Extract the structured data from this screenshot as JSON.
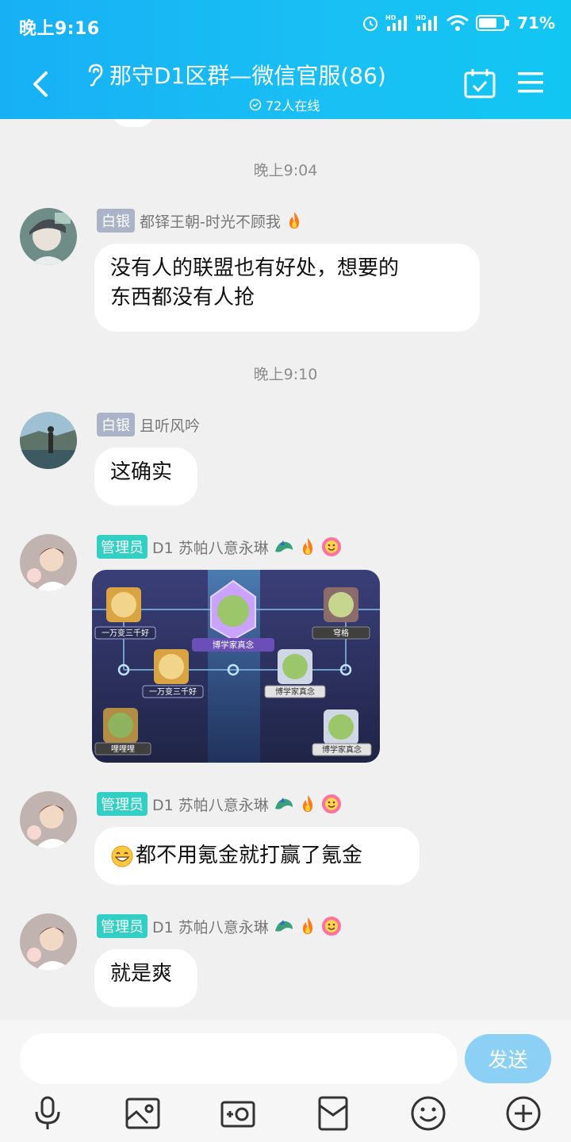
{
  "status_bar": {
    "time": "晚上9:16",
    "hd1": "HD",
    "hd2": "HD",
    "battery": "71%"
  },
  "header": {
    "title": "那守D1区群—微信官服(86)",
    "online": "72人在线"
  },
  "messages": [
    {
      "timestamp": "晚上9:04",
      "badge": "白银",
      "sender": "都铎王朝-时光不顾我",
      "text_line1": "没有人的联盟也有好处，想要的",
      "text_line2": "东西都没有人抢"
    },
    {
      "timestamp": "晚上9:10",
      "badge": "白银",
      "sender": "且听风吟",
      "text": "这确实"
    },
    {
      "badge": "管理员",
      "sender": "D1 苏帕八意永琳",
      "image": {
        "labels": [
          "一万变三千好",
          "穹格",
          "博学家真念",
          "一万变三千好",
          "博学家真念",
          "哩哩哩",
          "博学家真念"
        ]
      }
    },
    {
      "badge": "管理员",
      "sender": "D1 苏帕八意永琳",
      "text": "都不用氪金就打赢了氪金"
    },
    {
      "badge": "管理员",
      "sender": "D1 苏帕八意永琳",
      "text": "就是爽"
    }
  ],
  "input": {
    "placeholder": "",
    "send_label": "发送"
  },
  "icons": [
    "back-icon",
    "ear-icon",
    "calendar-icon",
    "menu-icon",
    "microphone-icon",
    "image-icon",
    "camera-icon",
    "red-packet-icon",
    "emoji-icon",
    "plus-icon"
  ],
  "colors": {
    "header_start": "#17b0f5",
    "header_end": "#12c6f2",
    "badge_silver": "#aab3c8",
    "badge_admin": "#31cfc4",
    "send_button": "#8cd0f5"
  }
}
